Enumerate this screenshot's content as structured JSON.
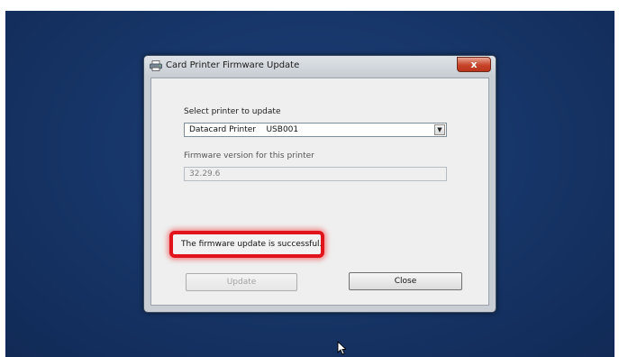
{
  "window": {
    "title": "Card Printer Firmware Update",
    "close_label": "x"
  },
  "form": {
    "select_label": "Select printer to update",
    "printer_name": "Datacard Printer",
    "printer_port": "USB001",
    "version_label": "Firmware version for this printer",
    "version_value": "32.29.6"
  },
  "status": {
    "message": "The firmware update is successful."
  },
  "buttons": {
    "update_label": "Update",
    "close_label": "Close"
  },
  "icons": {
    "app": "printer-icon",
    "dropdown": "chevron-down-icon",
    "cursor": "mouse-pointer-icon"
  }
}
